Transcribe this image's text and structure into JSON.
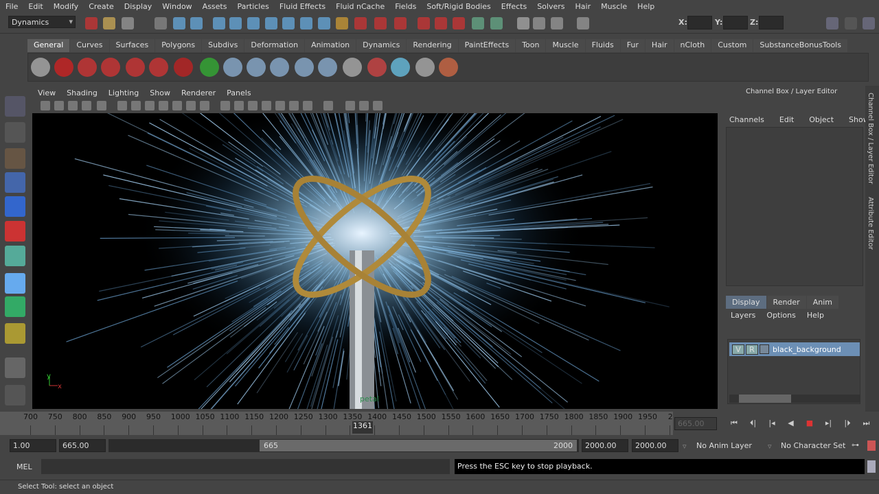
{
  "menu": [
    "File",
    "Edit",
    "Modify",
    "Create",
    "Display",
    "Window",
    "Assets",
    "Particles",
    "Fluid Effects",
    "Fluid nCache",
    "Fields",
    "Soft/Rigid Bodies",
    "Effects",
    "Solvers",
    "Hair",
    "Muscle",
    "Help"
  ],
  "status": {
    "mode": "Dynamics",
    "x_label": "X:",
    "y_label": "Y:",
    "z_label": "Z:"
  },
  "shelf_tabs": [
    "General",
    "Curves",
    "Surfaces",
    "Polygons",
    "Subdivs",
    "Deformation",
    "Animation",
    "Dynamics",
    "Rendering",
    "PaintEffects",
    "Toon",
    "Muscle",
    "Fluids",
    "Fur",
    "Hair",
    "nCloth",
    "Custom",
    "SubstanceBonusTools"
  ],
  "panel_menu": [
    "View",
    "Shading",
    "Lighting",
    "Show",
    "Renderer",
    "Panels"
  ],
  "viewport": {
    "axis_y": "y",
    "axis_x": "x",
    "object_label": "petal"
  },
  "channel_box": {
    "title": "Channel Box / Layer Editor",
    "menu": [
      "Channels",
      "Edit",
      "Object",
      "Show"
    ],
    "layer_tabs": [
      "Display",
      "Render",
      "Anim"
    ],
    "layer_menu": [
      "Layers",
      "Options",
      "Help"
    ],
    "layer": {
      "v": "V",
      "r": "R",
      "name": "black_background"
    }
  },
  "side_tabs": [
    "Channel Box / Layer Editor",
    "Attribute Editor"
  ],
  "timeline": {
    "ticks": [
      "700",
      "750",
      "800",
      "850",
      "900",
      "950",
      "1000",
      "1050",
      "1100",
      "1150",
      "1200",
      "1250",
      "1300",
      "1350",
      "1400",
      "1450",
      "1500",
      "1550",
      "1600",
      "1650",
      "1700",
      "1750",
      "1800",
      "1850",
      "1900",
      "1950",
      "2"
    ],
    "current_frame": "1361",
    "current_field": "665.00"
  },
  "range": {
    "start": "1.00",
    "playback_start": "665.00",
    "slider_start": "665",
    "slider_end": "2000",
    "playback_end": "2000.00",
    "end": "2000.00",
    "anim_layer": "No Anim Layer",
    "char_set": "No Character Set"
  },
  "command": {
    "label": "MEL",
    "result": "Press the ESC key to stop playback."
  },
  "help_line": "Select Tool: select an object"
}
